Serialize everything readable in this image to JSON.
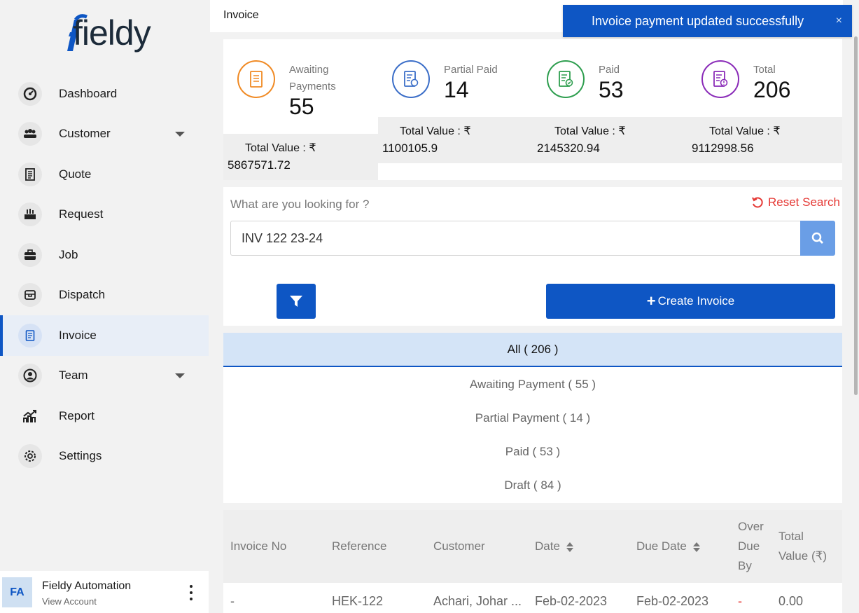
{
  "brand": {
    "logo_text": "fieldy"
  },
  "sidebar": {
    "items": [
      {
        "label": "Dashboard",
        "icon": "dashboard-icon"
      },
      {
        "label": "Customer",
        "icon": "customer-icon",
        "has_caret": true
      },
      {
        "label": "Quote",
        "icon": "quote-icon"
      },
      {
        "label": "Request",
        "icon": "request-icon"
      },
      {
        "label": "Job",
        "icon": "job-icon"
      },
      {
        "label": "Dispatch",
        "icon": "dispatch-icon"
      },
      {
        "label": "Invoice",
        "icon": "invoice-icon",
        "active": true
      },
      {
        "label": "Team",
        "icon": "team-icon",
        "has_caret": true
      },
      {
        "label": "Report",
        "icon": "report-icon"
      },
      {
        "label": "Settings",
        "icon": "settings-icon"
      }
    ],
    "account": {
      "initials": "FA",
      "name": "Fieldy Automation",
      "link": "View Account"
    }
  },
  "header": {
    "title": "Invoice"
  },
  "toast": {
    "message": "Invoice payment updated successfully",
    "close": "×",
    "color": "#0e56c4"
  },
  "stats": [
    {
      "label": "Awaiting Payments",
      "count": "55",
      "total_label": "Total Value : ₹",
      "total_value": "5867571.72",
      "color": "#f08a24"
    },
    {
      "label": "Partial Paid",
      "count": "14",
      "total_label": "Total Value : ₹",
      "total_value": "1100105.9",
      "color": "#3b6ec8"
    },
    {
      "label": "Paid",
      "count": "53",
      "total_label": "Total Value : ₹",
      "total_value": "2145320.94",
      "color": "#2e9e4f"
    },
    {
      "label": "Total",
      "count": "206",
      "total_label": "Total Value : ₹",
      "total_value": "9112998.56",
      "color": "#8a2bb8"
    }
  ],
  "search": {
    "question": "What are you looking for ?",
    "reset_label": "Reset Search",
    "value": "INV 122 23-24",
    "reset_color": "#e53935"
  },
  "actions": {
    "create_label": "Create Invoice",
    "create_plus": "+"
  },
  "tabs": [
    {
      "label": "All ( 206 )",
      "active": true
    },
    {
      "label": "Awaiting Payment ( 55 )"
    },
    {
      "label": "Partial Payment ( 14 )"
    },
    {
      "label": "Paid ( 53 )"
    },
    {
      "label": "Draft ( 84 )"
    }
  ],
  "table": {
    "headers": {
      "invoice_no": "Invoice No",
      "reference": "Reference",
      "customer": "Customer",
      "date": "Date",
      "due_date": "Due Date",
      "overdue": [
        "Over",
        "Due",
        "By"
      ],
      "total": [
        "Total",
        "Value (₹)"
      ]
    },
    "rows": [
      {
        "invoice_no": "-",
        "reference": "HEK-122",
        "customer": "Achari, Johar ...",
        "date": "Feb-02-2023",
        "due_date": "Feb-02-2023",
        "overdue": "-",
        "total": "0.00"
      }
    ]
  },
  "accent_color": "#0e56c4"
}
